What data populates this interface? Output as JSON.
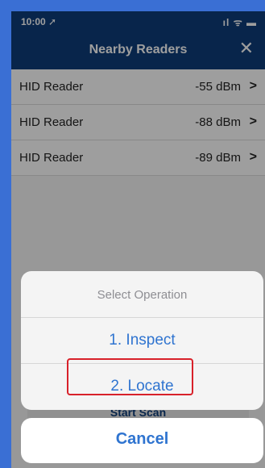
{
  "status_bar": {
    "time": "10:00",
    "location_glyph": "➚",
    "signal": "ıl",
    "wifi": "ᯤ",
    "battery": "▬"
  },
  "nav": {
    "title": "Nearby Readers",
    "close": "✕"
  },
  "readers": [
    {
      "name": "HID Reader",
      "rssi": "-55 dBm"
    },
    {
      "name": "HID Reader",
      "rssi": "-88 dBm"
    },
    {
      "name": "HID Reader",
      "rssi": "-89 dBm"
    }
  ],
  "chevron": ">",
  "scan_button": {
    "label": "Start Scan"
  },
  "action_sheet": {
    "title": "Select Operation",
    "options": [
      "1. Inspect",
      "2. Locate"
    ],
    "cancel": "Cancel"
  },
  "colors": {
    "nav": "#0e3d7a",
    "action": "#2f74d0",
    "highlight": "#d8212a",
    "frame": "#3a6fd4"
  }
}
